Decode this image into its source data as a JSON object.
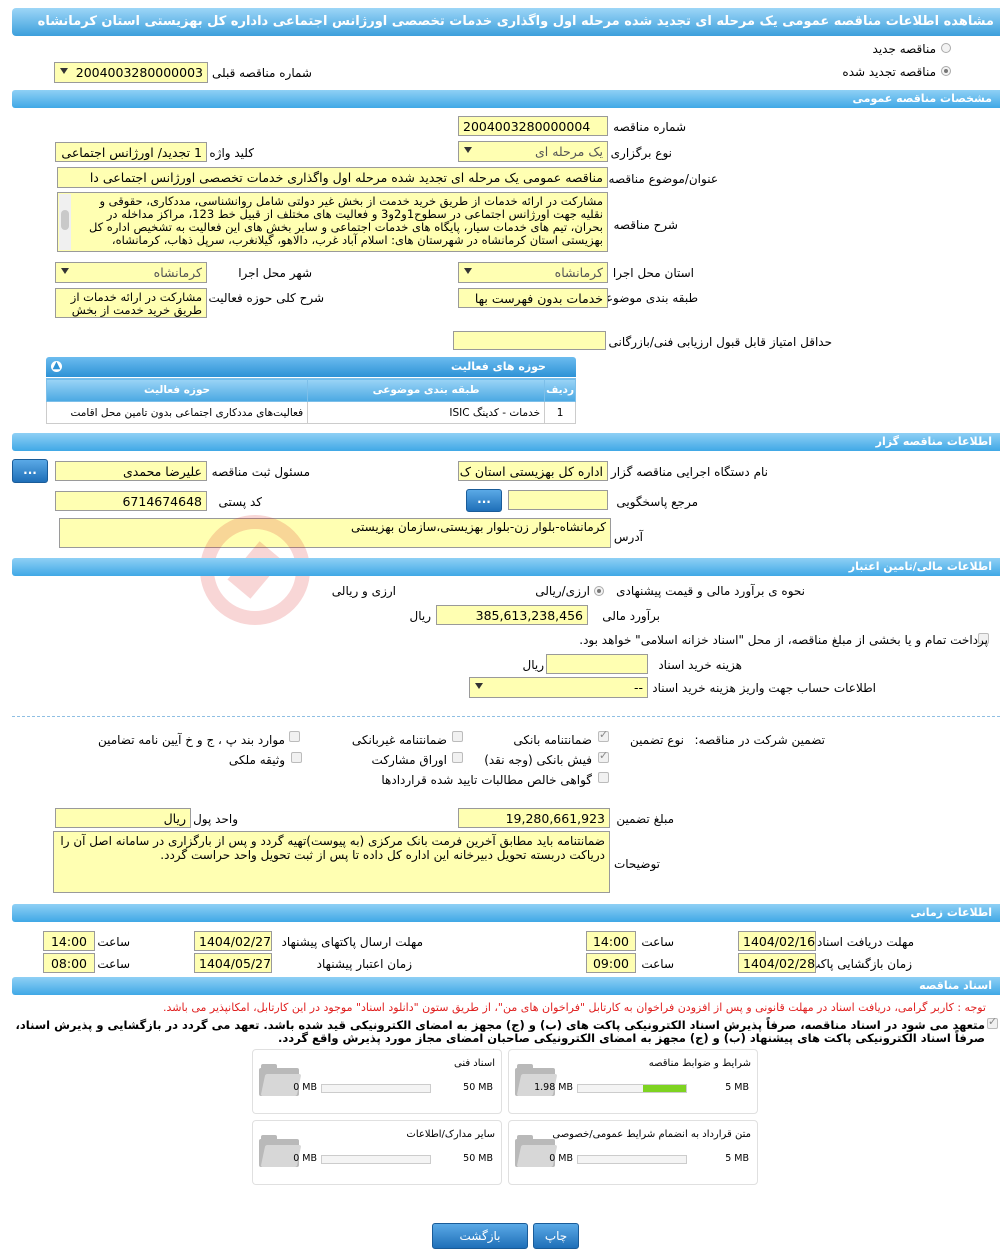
{
  "title": "مشاهده اطلاعات مناقصه عمومی یک مرحله ای تجدید شده مرحله اول واگذاری خدمات تخصصی اورژانس اجتماعی داداره کل بهزیستی استان کرمانشاه",
  "top": {
    "radio_new": "مناقصه جدید",
    "radio_renewed": "مناقصه تجدید شده",
    "prev_number_label": "شماره مناقصه قبلی",
    "prev_number_value": "2004003280000003"
  },
  "sections": {
    "general": "مشخصات مناقصه عمومی",
    "organizer": "اطلاعات مناقصه گزار",
    "financial": "اطلاعات مالی/تامین اعتبار",
    "timing": "اطلاعات زمانی",
    "documents": "اسناد مناقصه"
  },
  "general": {
    "number_label": "شماره مناقصه",
    "number_value": "2004003280000004",
    "type_label": "نوع برگزاری",
    "type_value": "یک مرحله ای",
    "keyword_label": "کلید واژه",
    "keyword_value": "1 تجدید/ اورژانس اجتماعی",
    "subject_label": "عنوان/موضوع مناقصه",
    "subject_value": "مناقصه عمومی یک مرحله ای  تجدید شده مرحله اول واگذاری خدمات  تخصصی اورژانس اجتماعی دا",
    "desc_label": "شرح مناقصه",
    "desc_value": "مشارکت در ارائه خدمات از طریق خرید خدمت از بخش غیر دولتی شامل روانشناسی، مددکاری، حقوقی و نقلیه جهت اورژانس اجتماعی در سطوح1و2و3 و فعالیت های مختلف از قبیل خط 123، مراکز مداخله در بحران، تیم های خدمات سیار، پایگاه های خدمات اجتماعی و سایر بخش های این فعالیت به تشخیص اداره کل بهزیستی استان کرمانشاه در شهرستان های: اسلام آباد غرب، دالاهو، گیلانغرب، سرپل ذهاب، کرمانشاه،",
    "province_label": "استان محل اجرا",
    "province_value": "کرمانشاه",
    "city_label": "شهر محل اجرا",
    "city_value": "کرمانشاه",
    "category_label": "طبقه بندی موضوعی",
    "category_value": "خدمات بدون فهرست بها",
    "scope_label": "شرح کلی حوزه فعالیت",
    "scope_value": "مشارکت در ارائه خدمات از طریق خرید خدمت از بخش",
    "minscore_label": "حداقل امتیاز قابل قبول ارزیابی فنی/بازرگانی",
    "minscore_value": ""
  },
  "activity_table": {
    "title": "حوزه های فعالیت",
    "columns": [
      "ردیف",
      "طبقه بندی موضوعی",
      "حوزه فعالیت"
    ],
    "rows": [
      [
        "1",
        "خدمات - کدینگ ISIC",
        "فعالیت‌های مددکاری اجتماعی بدون تامین محل اقامت"
      ]
    ]
  },
  "organizer": {
    "org_label": "نام دستگاه اجرایی مناقصه گزار",
    "org_value": "اداره کل بهزیستی استان ک",
    "responsible_label": "مسئول ثبت مناقصه",
    "responsible_value": "علیرضا محمدی",
    "ref_label": "مرجع پاسخگویی",
    "ref_value": "",
    "postal_label": "کد پستی",
    "postal_value": "6714674648",
    "address_label": "آدرس",
    "address_value": "کرمانشاه-بلوار زن-بلوار بهزیستی،سازمان بهزیستی",
    "more_button": "..."
  },
  "financial": {
    "method_label": "نحوه ی برآورد مالی و قیمت پیشنهادی",
    "opt_fx_rial": "ارزی/ریالی",
    "opt_fx_and_rial": "ارزی و ریالی",
    "estimate_label": "برآورد مالی",
    "estimate_value": "385,613,238,456",
    "estimate_unit": "ریال",
    "payment_text": "پرداخت تمام و یا بخشی از مبلغ مناقصه، از محل \"اسناد خزانه اسلامی\" خواهد بود.",
    "doc_cost_label": "هزینه خرید اسناد",
    "doc_cost_unit": "ریال",
    "doc_cost_value": "",
    "account_label": "اطلاعات حساب جهت واریز هزینه خرید اسناد",
    "account_value": "--"
  },
  "guarantee": {
    "title": "تضمین شرکت در مناقصه:",
    "type_label": "نوع تضمین",
    "opt_bank": "ضمانتنامه بانکی",
    "opt_nonbank": "ضمانتنامه غیربانکی",
    "opt_items": "موارد بند پ ، ج و خ آیین نامه تضامین",
    "opt_cash": "فیش بانکی (وجه نقد)",
    "opt_bonds": "اوراق مشارکت",
    "opt_property": "وثیقه ملکی",
    "opt_receivables": "گواهی خالص مطالبات تایید شده قراردادها",
    "amount_label": "مبلغ تضمین",
    "amount_value": "19,280,661,923",
    "currency_label": "واحد پول",
    "currency_value": "ریال",
    "notes_label": "توضیحات",
    "notes_value": "ضمانتنامه باید مطابق آخرین فرمت بانک مرکزی (به پیوست)تهیه گردد و پس از بارگزاری در سامانه اصل آن را دریاکت دربسته تحویل دبیرخانه این اداره کل داده تا پس از ثبت  تحویل واحد حراست گردد."
  },
  "timing": {
    "receive_deadline_label": "مهلت دریافت اسناد",
    "receive_deadline_date": "1404/02/16",
    "receive_deadline_time": "14:00",
    "send_deadline_label": "مهلت ارسال پاکتهای پیشنهاد",
    "send_deadline_date": "1404/02/27",
    "send_deadline_time": "14:00",
    "opening_label": "زمان بازگشایی پاکت ها",
    "opening_date": "1404/02/28",
    "opening_time": "09:00",
    "validity_label": "زمان اعتبار پیشنهاد",
    "validity_date": "1404/05/27",
    "validity_time": "08:00",
    "time_label": "ساعت"
  },
  "documents": {
    "notice": "توجه : کاربر گرامی، دریافت اسناد در مهلت قانونی و پس از افزودن فراخوان به کارتابل \"فراخوان های من\"، از طریق ستون \"دانلود اسناد\" موجود در این کارتابل، امکانپذیر می باشد.",
    "commit_line1": "متعهد می شود در اسناد مناقصه، صرفاً پذیرش اسناد الکترونیکی پاکت های (ب) و (ج) مجهز به امضای الکترونیکی قید شده باشد. تعهد می گردد در بازگشایی و پذیرش اسناد،",
    "commit_line2": "صرفاً اسناد الکترونیکی پاکت های پیشنهاد (ب) و (ج) مجهز به امضای الکترونیکی صاحبان امضای مجاز مورد پذیرش واقع گردد.",
    "files": [
      {
        "name": "شرایط و ضوابط مناقصه",
        "used": "1.98 MB",
        "max": "5 MB",
        "fraction": 0.396
      },
      {
        "name": "اسناد فنی",
        "used": "0 MB",
        "max": "50 MB",
        "fraction": 0
      },
      {
        "name": "متن قرارداد به انضمام شرایط عمومی/خصوصی",
        "used": "0 MB",
        "max": "5 MB",
        "fraction": 0
      },
      {
        "name": "سایر مدارک/اطلاعات",
        "used": "0 MB",
        "max": "50 MB",
        "fraction": 0
      }
    ]
  },
  "buttons": {
    "print": "چاپ",
    "back": "بازگشت"
  }
}
